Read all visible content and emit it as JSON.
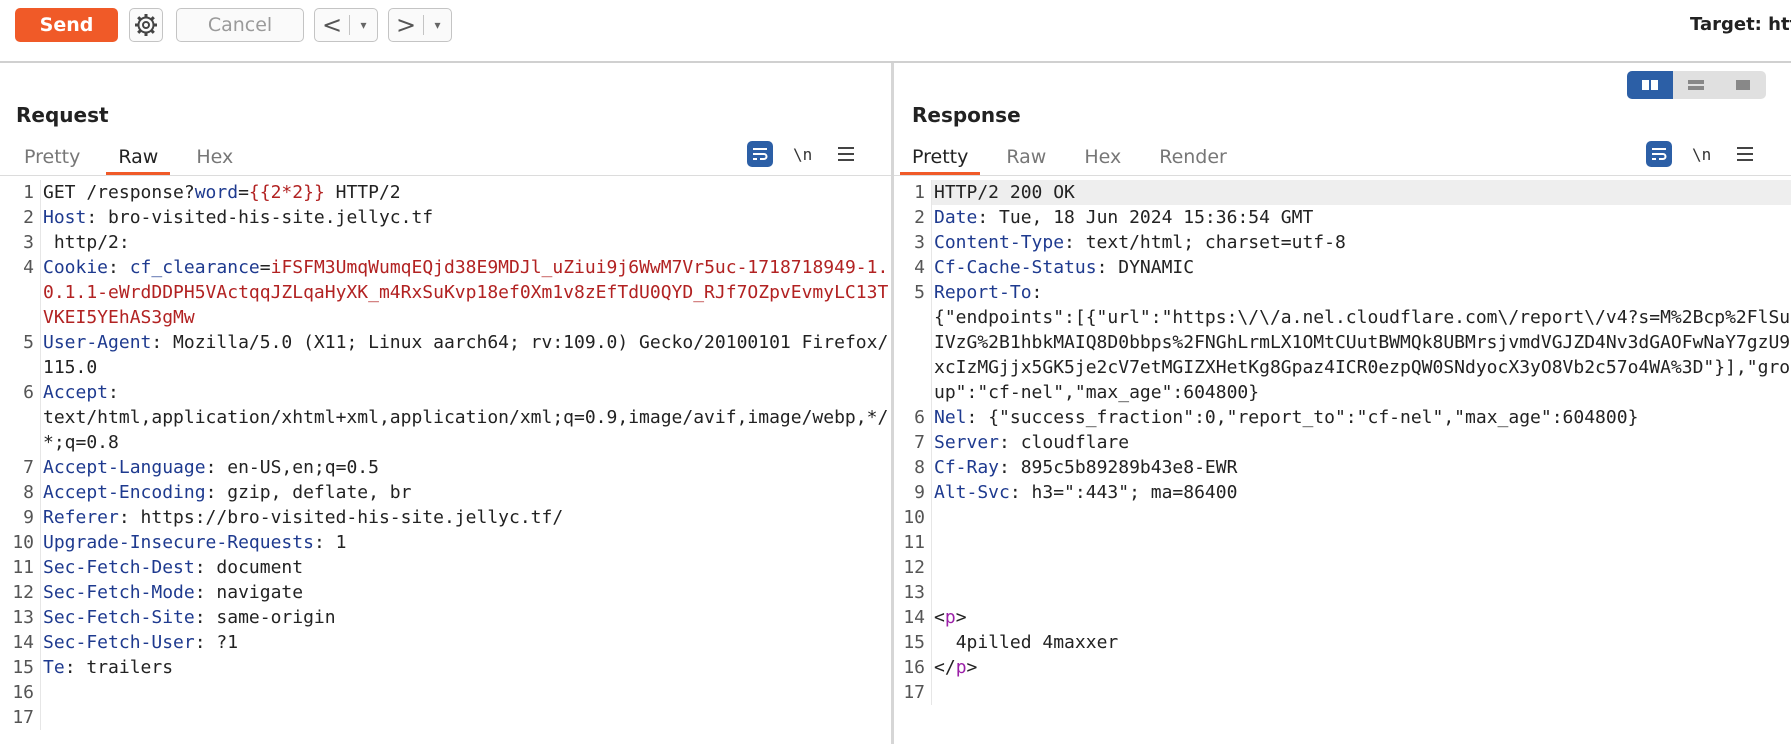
{
  "toolbar": {
    "send_label": "Send",
    "cancel_label": "Cancel",
    "prev_arrow": "<",
    "next_arrow": ">",
    "dropdown_glyph": "▾",
    "target_label": "Target: http"
  },
  "request": {
    "title": "Request",
    "tabs": [
      "Pretty",
      "Raw",
      "Hex"
    ],
    "active_tab": "Raw",
    "newline_tool": "\\n",
    "lines": [
      {
        "n": "1",
        "parts": [
          [
            "t",
            "GET /response?"
          ],
          [
            "hn",
            "word"
          ],
          [
            "t",
            "="
          ],
          [
            "pv",
            "{{2*2}}"
          ],
          [
            "t",
            " HTTP/2"
          ]
        ]
      },
      {
        "n": "2",
        "parts": [
          [
            "hn",
            "Host"
          ],
          [
            "t",
            ": bro-visited-his-site.jellyc.tf"
          ]
        ]
      },
      {
        "n": "3",
        "parts": [
          [
            "t",
            " http/2:"
          ]
        ]
      },
      {
        "n": "4",
        "parts": [
          [
            "hn",
            "Cookie"
          ],
          [
            "t",
            ": "
          ],
          [
            "pn",
            "cf_clearance"
          ],
          [
            "t",
            "="
          ],
          [
            "ck",
            "iFSFM3UmqWumqEQjd38E9MDJl_uZiui9j6WwM7Vr5uc-1718718949-1.0.1.1-eWrdDDPH5VActqqJZLqaHyXK_m4RxSuKvp18ef0Xm1v8zEfTdU0QYD_RJf7OZpvEvmyLC13TVKEI5YEhAS3gMw"
          ]
        ]
      },
      {
        "n": "5",
        "parts": [
          [
            "hn",
            "User-Agent"
          ],
          [
            "t",
            ": Mozilla/5.0 (X11; Linux aarch64; rv:109.0) Gecko/20100101 Firefox/115.0"
          ]
        ]
      },
      {
        "n": "6",
        "parts": [
          [
            "hn",
            "Accept"
          ],
          [
            "t",
            ":\ntext/html,application/xhtml+xml,application/xml;q=0.9,image/avif,image/webp,*/*;q=0.8"
          ]
        ]
      },
      {
        "n": "7",
        "parts": [
          [
            "hn",
            "Accept-Language"
          ],
          [
            "t",
            ": en-US,en;q=0.5"
          ]
        ]
      },
      {
        "n": "8",
        "parts": [
          [
            "hn",
            "Accept-Encoding"
          ],
          [
            "t",
            ": gzip, deflate, br"
          ]
        ]
      },
      {
        "n": "9",
        "parts": [
          [
            "hn",
            "Referer"
          ],
          [
            "t",
            ": https://bro-visited-his-site.jellyc.tf/"
          ]
        ]
      },
      {
        "n": "10",
        "parts": [
          [
            "hn",
            "Upgrade-Insecure-Requests"
          ],
          [
            "t",
            ": 1"
          ]
        ]
      },
      {
        "n": "11",
        "parts": [
          [
            "hn",
            "Sec-Fetch-Dest"
          ],
          [
            "t",
            ": document"
          ]
        ]
      },
      {
        "n": "12",
        "parts": [
          [
            "hn",
            "Sec-Fetch-Mode"
          ],
          [
            "t",
            ": navigate"
          ]
        ]
      },
      {
        "n": "13",
        "parts": [
          [
            "hn",
            "Sec-Fetch-Site"
          ],
          [
            "t",
            ": same-origin"
          ]
        ]
      },
      {
        "n": "14",
        "parts": [
          [
            "hn",
            "Sec-Fetch-User"
          ],
          [
            "t",
            ": ?1"
          ]
        ]
      },
      {
        "n": "15",
        "parts": [
          [
            "hn",
            "Te"
          ],
          [
            "t",
            ": trailers"
          ]
        ]
      },
      {
        "n": "16",
        "parts": []
      },
      {
        "n": "17",
        "parts": []
      }
    ]
  },
  "response": {
    "title": "Response",
    "tabs": [
      "Pretty",
      "Raw",
      "Hex",
      "Render"
    ],
    "active_tab": "Pretty",
    "newline_tool": "\\n",
    "lines": [
      {
        "n": "1",
        "parts": [
          [
            "t",
            "HTTP/2 200 OK"
          ]
        ]
      },
      {
        "n": "2",
        "parts": [
          [
            "hn",
            "Date"
          ],
          [
            "t",
            ": Tue, 18 Jun 2024 15:36:54 GMT"
          ]
        ]
      },
      {
        "n": "3",
        "parts": [
          [
            "hn",
            "Content-Type"
          ],
          [
            "t",
            ": text/html; charset=utf-8"
          ]
        ]
      },
      {
        "n": "4",
        "parts": [
          [
            "hn",
            "Cf-Cache-Status"
          ],
          [
            "t",
            ": DYNAMIC"
          ]
        ]
      },
      {
        "n": "5",
        "parts": [
          [
            "hn",
            "Report-To"
          ],
          [
            "t",
            ":\n{\"endpoints\":[{\"url\":\"https:\\/\\/a.nel.cloudflare.com\\/report\\/v4?s=M%2Bcp%2FlSuIVzG%2B1hbkMAIQ8D0bbps%2FNGhLrmLX1OMtCUutBWMQk8UBMrsjvmdVGJZD4Nv3dGAOFwNaY7gzU9xcIzMGjjx5GK5je2cV7etMGIZXHetKg8Gpaz4ICR0ezpQW0SNdyocX3yO8Vb2c57o4WA%3D\"}],\"group\":\"cf-nel\",\"max_age\":604800}"
          ]
        ]
      },
      {
        "n": "6",
        "parts": [
          [
            "hn",
            "Nel"
          ],
          [
            "t",
            ": {\"success_fraction\":0,\"report_to\":\"cf-nel\",\"max_age\":604800}"
          ]
        ]
      },
      {
        "n": "7",
        "parts": [
          [
            "hn",
            "Server"
          ],
          [
            "t",
            ": cloudflare"
          ]
        ]
      },
      {
        "n": "8",
        "parts": [
          [
            "hn",
            "Cf-Ray"
          ],
          [
            "t",
            ": 895c5b89289b43e8-EWR"
          ]
        ]
      },
      {
        "n": "9",
        "parts": [
          [
            "hn",
            "Alt-Svc"
          ],
          [
            "t",
            ": h3=\":443\"; ma=86400"
          ]
        ]
      },
      {
        "n": "10",
        "parts": []
      },
      {
        "n": "11",
        "parts": []
      },
      {
        "n": "12",
        "parts": []
      },
      {
        "n": "13",
        "parts": []
      },
      {
        "n": "14",
        "parts": [
          [
            "t",
            "<"
          ],
          [
            "tag",
            "p"
          ],
          [
            "t",
            ">"
          ]
        ]
      },
      {
        "n": "15",
        "parts": [
          [
            "t",
            "  4pilled 4maxxer"
          ]
        ]
      },
      {
        "n": "16",
        "parts": [
          [
            "t",
            "</"
          ],
          [
            "tag",
            "p"
          ],
          [
            "t",
            ">"
          ]
        ]
      },
      {
        "n": "17",
        "parts": []
      }
    ]
  },
  "colors": {
    "accent": "#f05a28",
    "toggle_active": "#2c5fa6",
    "header_name": "#1e3a8f",
    "param_value": "#b22222",
    "html_tag": "#9b1fa8"
  }
}
